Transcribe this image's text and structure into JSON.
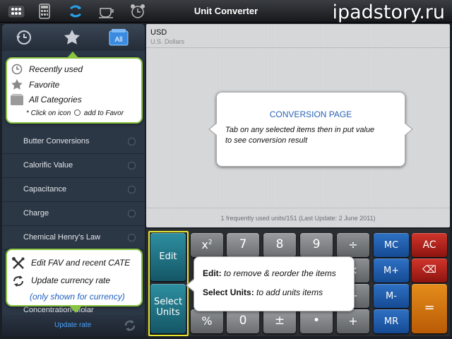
{
  "app": {
    "title": "Unit Converter",
    "watermark": "ipadstory.ru"
  },
  "topbar_icons": [
    "apps-grid-icon",
    "calculator-icon",
    "link-convert-icon",
    "coffee-cup-icon",
    "alarm-clock-icon"
  ],
  "sidebar": {
    "tabs": [
      {
        "name": "recent-tab",
        "icon": "clock-history-icon"
      },
      {
        "name": "favorite-tab",
        "icon": "star-icon"
      },
      {
        "name": "all-categories-tab",
        "icon": "all-folder-icon",
        "label": "All"
      }
    ],
    "items": [
      {
        "label": "Butter Conversions"
      },
      {
        "label": "Calorific Value"
      },
      {
        "label": "Capacitance"
      },
      {
        "label": "Charge"
      },
      {
        "label": "Chemical Henry's Law"
      },
      {
        "label": "Concentration-Molar"
      }
    ],
    "update_rate": "Update rate"
  },
  "legend_callout": {
    "recent": "Recently used",
    "favorite": "Favorite",
    "all": "All Categories",
    "note_before": "* Click on icon",
    "note_after": "add to Favor"
  },
  "side_edit_callout": {
    "edit": "Edit FAV and recent CATE",
    "update": "Update currency rate",
    "only": "(only shown for currency)"
  },
  "main": {
    "unit_code": "USD",
    "unit_name": "U.S. Dollars",
    "status": "1 frequently used units/151 (Last Update: 2 June 2011)"
  },
  "conversion_callout": {
    "title": "CONVERSION PAGE",
    "line1": "Tab on any selected items then in put value",
    "line2": "to see conversion result"
  },
  "edit_callout": {
    "edit_bold": "Edit:",
    "edit_text": "to remove & reorder the items",
    "select_bold": "Select Units:",
    "select_text": "to add units items"
  },
  "keypad": {
    "edit": "Edit",
    "select_line1": "Select",
    "select_line2": "Units",
    "x2": "x",
    "x2_sup": "2",
    "percent": "%",
    "digits_row1": [
      "7",
      "8",
      "9"
    ],
    "zero": "0",
    "plusminus": "±",
    "dot": "•",
    "div": "÷",
    "mul": "×",
    "minus": "−",
    "plus": "+",
    "mc": "MC",
    "mplus": "M+",
    "mminus": "M-",
    "mr": "MR",
    "ac": "AC",
    "backspace": "⌫",
    "equals": "="
  },
  "colors": {
    "accent_green": "#88c440",
    "highlight_yellow": "#e4e62f",
    "link_blue": "#4aa3ff",
    "title_blue": "#2a62b7"
  }
}
